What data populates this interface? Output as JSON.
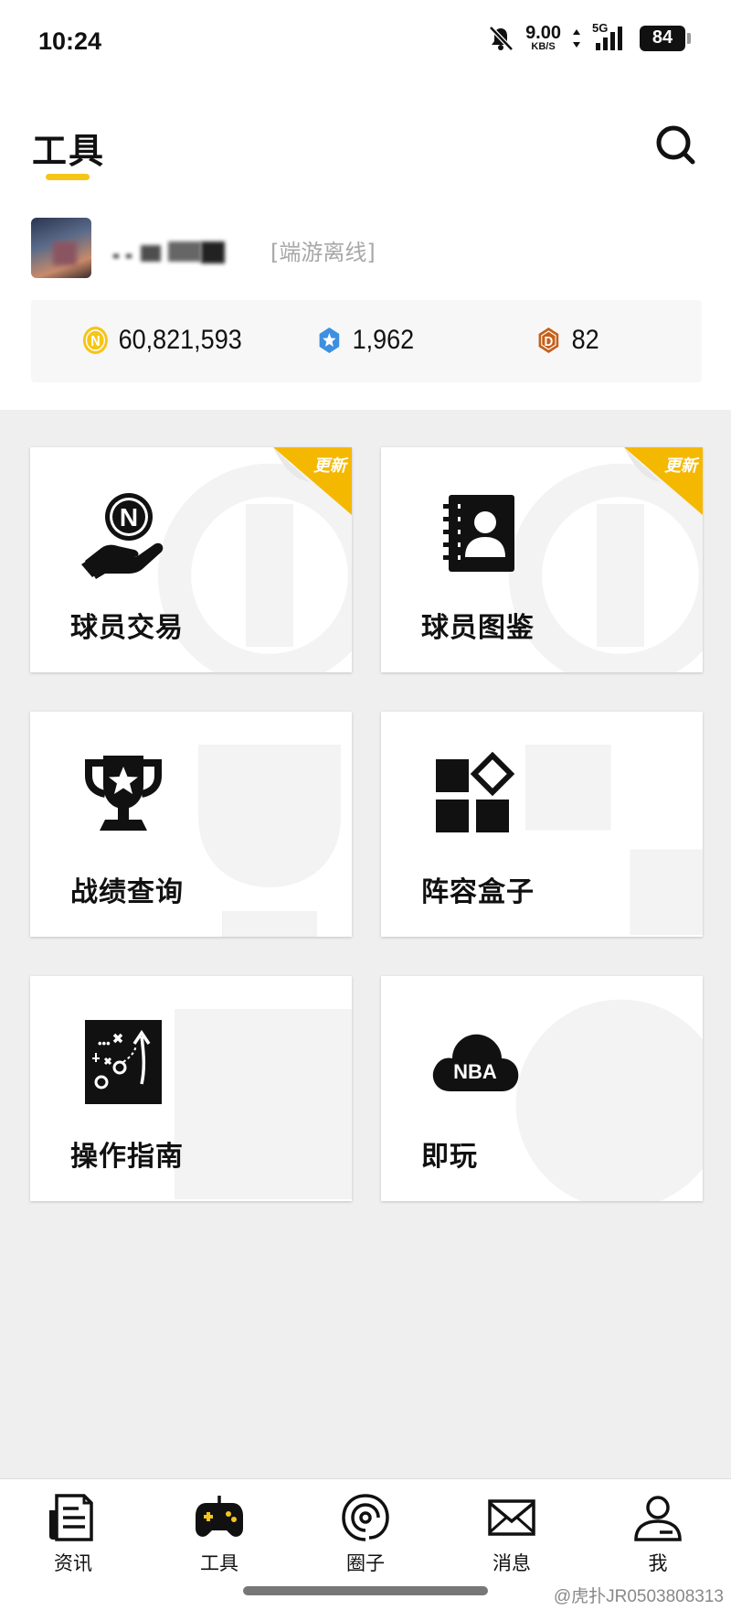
{
  "status_bar": {
    "time": "10:24",
    "net_speed": "9.00",
    "net_unit": "KB/S",
    "network": "5G",
    "battery": "84",
    "icons": [
      "mute-bell-icon",
      "data-arrows-icon",
      "signal-icon",
      "battery-icon"
    ]
  },
  "header": {
    "title": "工具",
    "search_icon": "search-icon",
    "accent_color": "#f5c518"
  },
  "user": {
    "status": "[端游离线]"
  },
  "currencies": [
    {
      "icon": "n-coin-icon",
      "value": "60,821,593",
      "color": "#f5c518"
    },
    {
      "icon": "star-badge-icon",
      "value": "1,962",
      "color": "#3d8fe0"
    },
    {
      "icon": "d-hexagon-icon",
      "value": "82",
      "color": "#c5601b"
    }
  ],
  "tools": [
    {
      "label": "球员交易",
      "icon": "hand-coin-icon",
      "badge": "更新"
    },
    {
      "label": "球员图鉴",
      "icon": "contact-book-icon",
      "badge": "更新"
    },
    {
      "label": "战绩查询",
      "icon": "trophy-icon",
      "badge": ""
    },
    {
      "label": "阵容盒子",
      "icon": "grid-diamond-icon",
      "badge": ""
    },
    {
      "label": "操作指南",
      "icon": "tactics-board-icon",
      "badge": ""
    },
    {
      "label": "即玩",
      "icon": "nba-cloud-icon",
      "badge": ""
    }
  ],
  "nav": [
    {
      "label": "资讯",
      "icon": "news-icon",
      "active": false
    },
    {
      "label": "工具",
      "icon": "gamepad-icon",
      "active": true
    },
    {
      "label": "圈子",
      "icon": "circle-icon",
      "active": false
    },
    {
      "label": "消息",
      "icon": "mail-icon",
      "active": false
    },
    {
      "label": "我",
      "icon": "user-icon",
      "active": false
    }
  ],
  "credit": "@虎扑JR0503808313"
}
